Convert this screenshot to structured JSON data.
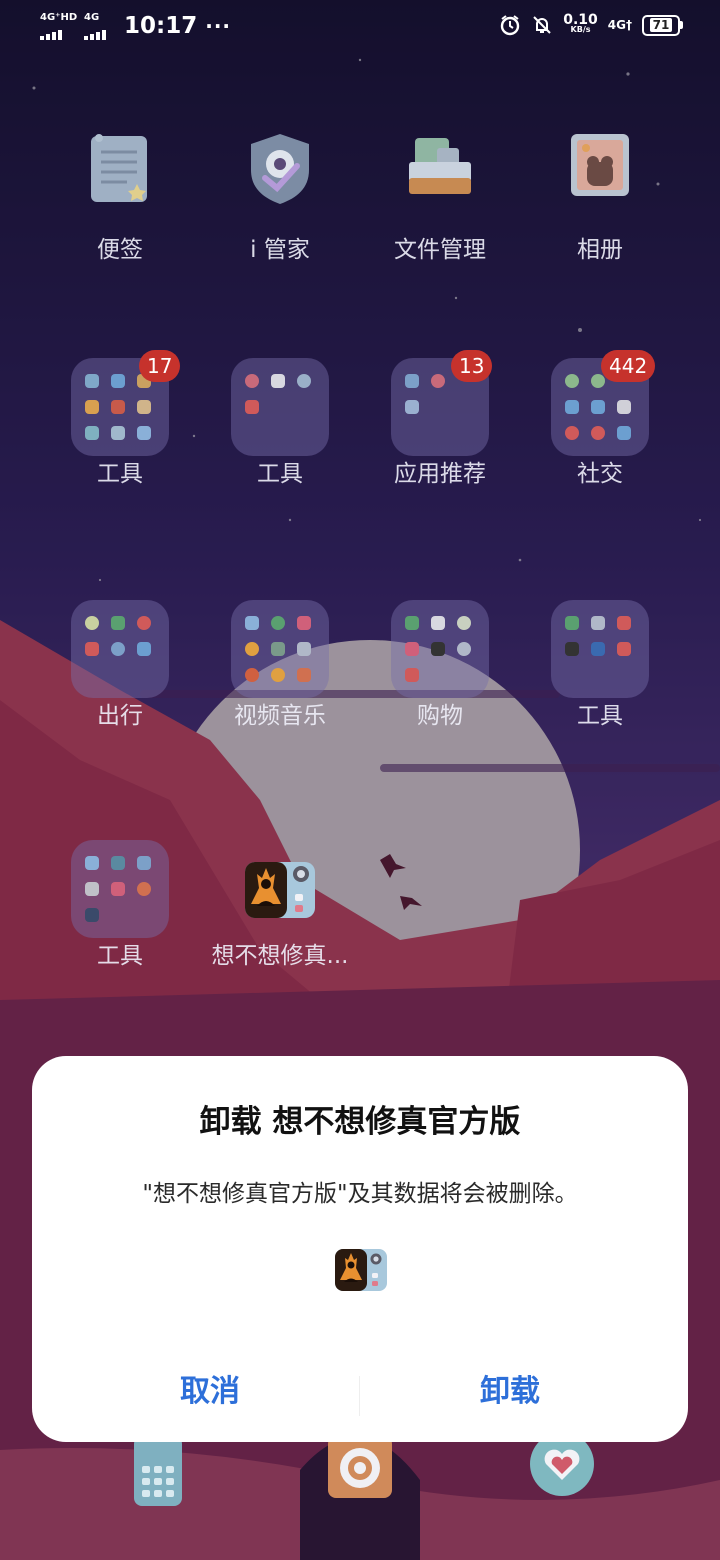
{
  "status_bar": {
    "sim1_label": "4G⁺HD",
    "sim2_label": "4G",
    "time": "10:17",
    "more": "···",
    "speed_value": "0.10",
    "speed_unit": "KB/s",
    "network": "4G†",
    "battery": "71",
    "icons": [
      "signal-icon",
      "signal-icon",
      "alarm-icon",
      "mute-bell-icon",
      "battery-icon"
    ]
  },
  "home": {
    "row1": [
      {
        "label": "便签",
        "icon": "note-icon"
      },
      {
        "label": "i 管家",
        "icon": "shield-icon"
      },
      {
        "label": "文件管理",
        "icon": "folder-files-icon"
      },
      {
        "label": "相册",
        "icon": "photo-album-icon"
      }
    ],
    "row2": [
      {
        "label": "工具",
        "badge": "17"
      },
      {
        "label": "工具",
        "badge": ""
      },
      {
        "label": "应用推荐",
        "badge": "13"
      },
      {
        "label": "社交",
        "badge": "442"
      }
    ],
    "row3": [
      {
        "label": "出行"
      },
      {
        "label": "视频音乐"
      },
      {
        "label": "购物"
      },
      {
        "label": "工具"
      }
    ],
    "row4": [
      {
        "label": "工具"
      },
      {
        "label": "想不想修真...",
        "icon": "xiuzhen-app-icon"
      }
    ],
    "dock_icons": [
      "phone-icon",
      "camera-icon",
      "messages-icon"
    ]
  },
  "dialog": {
    "title": "卸载 想不想修真官方版",
    "message": "\"想不想修真官方版\"及其数据将会被删除。",
    "cancel": "取消",
    "uninstall": "卸载",
    "accent": "#2d6fd9"
  }
}
